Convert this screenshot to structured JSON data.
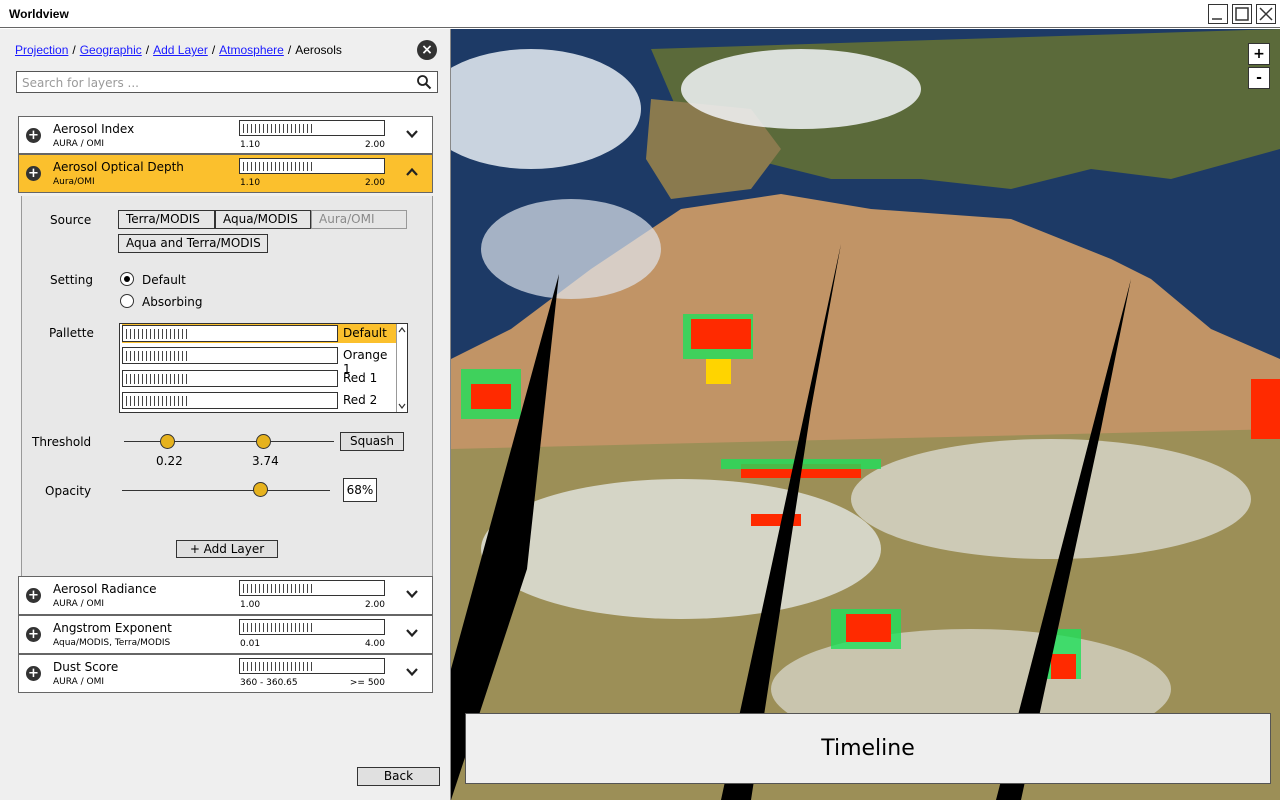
{
  "window": {
    "title": "Worldview"
  },
  "breadcrumb": [
    {
      "label": "Projection",
      "link": true
    },
    {
      "label": "Geographic",
      "link": true
    },
    {
      "label": "Add Layer",
      "link": true
    },
    {
      "label": "Atmosphere",
      "link": true
    },
    {
      "label": "Aerosols",
      "link": false
    }
  ],
  "search": {
    "placeholder": "Search for layers ..."
  },
  "layers": [
    {
      "name": "Aerosol Index",
      "source": "AURA / OMI",
      "min": "1.10",
      "max": "2.00"
    },
    {
      "name": "Aerosol Optical Depth",
      "source": "Aura/OMI",
      "min": "1.10",
      "max": "2.00"
    },
    {
      "name": "Aerosol Radiance",
      "source": "AURA / OMI",
      "min": "1.00",
      "max": "2.00"
    },
    {
      "name": "Angstrom Exponent",
      "source": "Aqua/MODIS, Terra/MODIS",
      "min": "0.01",
      "max": "4.00"
    },
    {
      "name": "Dust Score",
      "source": "AURA / OMI",
      "min": "360 - 360.65",
      "max": ">= 500"
    }
  ],
  "details": {
    "source_label": "Source",
    "sources": [
      "Terra/MODIS",
      "Aqua/MODIS",
      "Aura/OMI",
      "Aqua and Terra/MODIS"
    ],
    "setting_label": "Setting",
    "settings": [
      "Default",
      "Absorbing"
    ],
    "setting_selected": "Default",
    "palette_label": "Pallette",
    "palettes": [
      "Default",
      "Orange 1",
      "Red 1",
      "Red 2"
    ],
    "palette_selected": "Default",
    "threshold_label": "Threshold",
    "threshold_min": "0.22",
    "threshold_max": "3.74",
    "squash_label": "Squash",
    "opacity_label": "Opacity",
    "opacity_value": "68%",
    "add_layer_label": "+ Add Layer"
  },
  "back_label": "Back",
  "map": {
    "zoom_in": "+",
    "zoom_out": "-",
    "timeline_label": "Timeline"
  },
  "colors": {
    "active": "#fbc02d",
    "knob": "#e6b21d",
    "link": "#1a1aff"
  }
}
